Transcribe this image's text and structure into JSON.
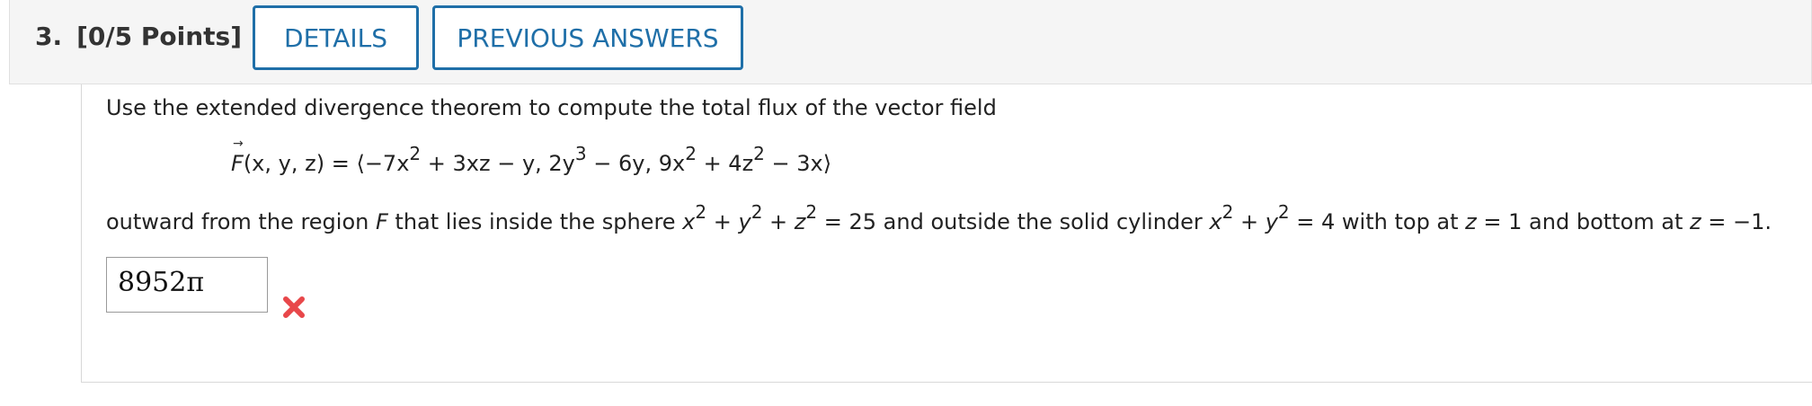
{
  "header": {
    "question_number": "3.",
    "points": "[0/5 Points]",
    "details_button": "DETAILS",
    "previous_answers_button": "PREVIOUS ANSWERS"
  },
  "question": {
    "intro": "Use the extended divergence theorem to compute the total flux of the vector field",
    "formula": {
      "lhs_vec": "F",
      "lhs_args": "(x, y, z) = ",
      "langle": "⟨",
      "c1a": "−7x",
      "c1b": " + 3xz − y, 2y",
      "c1c": " − 6y, 9x",
      "c1d": " + 4z",
      "c1e": " − 3x",
      "rangle": "⟩",
      "exp2": "2",
      "exp3": "3"
    },
    "outro": {
      "t1": "outward from the region ",
      "region": "F",
      "t2": " that lies inside the sphere ",
      "x": "x",
      "y": "y",
      "z": "z",
      "plus": " + ",
      "eq25": " = 25 and outside the solid cylinder ",
      "eq4": " = 4 with top at ",
      "top_val": " = 1 and bottom at ",
      "bot_val": " = −1.",
      "exp2": "2"
    }
  },
  "answer": {
    "value": "8952π",
    "status": "incorrect",
    "status_icon": "x-mark-icon",
    "status_color": "#e8474a"
  },
  "colors": {
    "accent": "#1f6fa8",
    "header_bg": "#f5f5f5"
  }
}
